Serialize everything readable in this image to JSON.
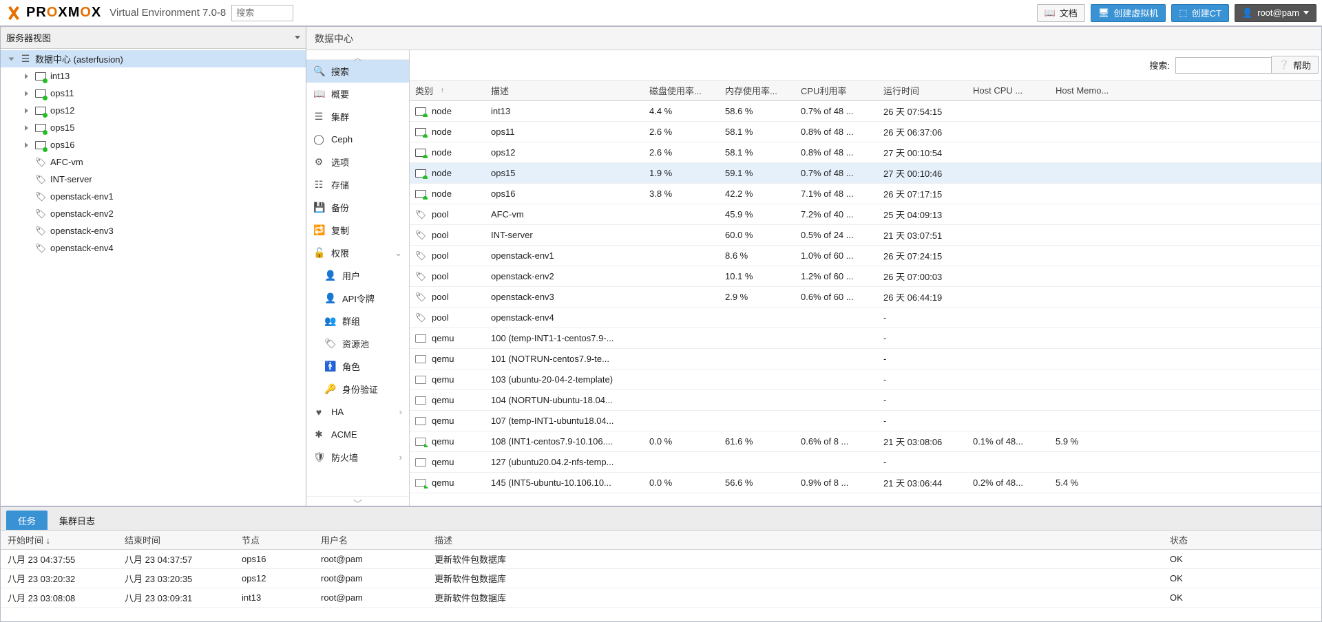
{
  "header": {
    "product": "PROXMOX",
    "suffix": "Virtual Environment 7.0-8",
    "search_placeholder": "搜索",
    "docs": "文档",
    "create_vm": "创建虚拟机",
    "create_ct": "创建CT",
    "user": "root@pam"
  },
  "help_label": "帮助",
  "left": {
    "view": "服务器视图",
    "dc_label": "数据中心 (asterfusion)",
    "nodes": [
      "int13",
      "ops11",
      "ops12",
      "ops15",
      "ops16"
    ],
    "pools": [
      "AFC-vm",
      "INT-server",
      "openstack-env1",
      "openstack-env2",
      "openstack-env3",
      "openstack-env4"
    ]
  },
  "center": {
    "title": "数据中心",
    "search_label": "搜索:",
    "menu": {
      "search": "搜索",
      "summary": "概要",
      "cluster": "集群",
      "ceph": "Ceph",
      "options": "选项",
      "storage": "存储",
      "backup": "备份",
      "replication": "复制",
      "permissions": "权限",
      "users": "用户",
      "api_tokens": "API令牌",
      "groups": "群组",
      "pools": "资源池",
      "roles": "角色",
      "auth": "身份验证",
      "ha": "HA",
      "acme": "ACME",
      "firewall": "防火墙"
    },
    "columns": {
      "type": "类别",
      "desc": "描述",
      "disk": "磁盘使用率...",
      "mem": "内存使用率...",
      "cpu": "CPU利用率",
      "uptime": "运行时间",
      "hostcpu": "Host CPU ...",
      "hostmem": "Host Memo..."
    },
    "rows": [
      {
        "icon": "node",
        "type": "node",
        "desc": "int13",
        "disk": "4.4 %",
        "mem": "58.6 %",
        "cpu": "0.7% of 48 ...",
        "up": "26 天 07:54:15",
        "hcpu": "",
        "hmem": ""
      },
      {
        "icon": "node",
        "type": "node",
        "desc": "ops11",
        "disk": "2.6 %",
        "mem": "58.1 %",
        "cpu": "0.8% of 48 ...",
        "up": "26 天 06:37:06",
        "hcpu": "",
        "hmem": ""
      },
      {
        "icon": "node",
        "type": "node",
        "desc": "ops12",
        "disk": "2.6 %",
        "mem": "58.1 %",
        "cpu": "0.8% of 48 ...",
        "up": "27 天 00:10:54",
        "hcpu": "",
        "hmem": ""
      },
      {
        "icon": "node",
        "type": "node",
        "desc": "ops15",
        "disk": "1.9 %",
        "mem": "59.1 %",
        "cpu": "0.7% of 48 ...",
        "up": "27 天 00:10:46",
        "hcpu": "",
        "hmem": "",
        "hover": true
      },
      {
        "icon": "node",
        "type": "node",
        "desc": "ops16",
        "disk": "3.8 %",
        "mem": "42.2 %",
        "cpu": "7.1% of 48 ...",
        "up": "26 天 07:17:15",
        "hcpu": "",
        "hmem": ""
      },
      {
        "icon": "pool",
        "type": "pool",
        "desc": "AFC-vm",
        "disk": "",
        "mem": "45.9 %",
        "cpu": "7.2% of 40 ...",
        "up": "25 天 04:09:13",
        "hcpu": "",
        "hmem": ""
      },
      {
        "icon": "pool",
        "type": "pool",
        "desc": "INT-server",
        "disk": "",
        "mem": "60.0 %",
        "cpu": "0.5% of 24 ...",
        "up": "21 天 03:07:51",
        "hcpu": "",
        "hmem": ""
      },
      {
        "icon": "pool",
        "type": "pool",
        "desc": "openstack-env1",
        "disk": "",
        "mem": "8.6 %",
        "cpu": "1.0% of 60 ...",
        "up": "26 天 07:24:15",
        "hcpu": "",
        "hmem": ""
      },
      {
        "icon": "pool",
        "type": "pool",
        "desc": "openstack-env2",
        "disk": "",
        "mem": "10.1 %",
        "cpu": "1.2% of 60 ...",
        "up": "26 天 07:00:03",
        "hcpu": "",
        "hmem": ""
      },
      {
        "icon": "pool",
        "type": "pool",
        "desc": "openstack-env3",
        "disk": "",
        "mem": "2.9 %",
        "cpu": "0.6% of 60 ...",
        "up": "26 天 06:44:19",
        "hcpu": "",
        "hmem": ""
      },
      {
        "icon": "pool",
        "type": "pool",
        "desc": "openstack-env4",
        "disk": "",
        "mem": "",
        "cpu": "",
        "up": "-",
        "hcpu": "",
        "hmem": ""
      },
      {
        "icon": "vm-off",
        "type": "qemu",
        "desc": "100 (temp-INT1-1-centos7.9-...",
        "disk": "",
        "mem": "",
        "cpu": "",
        "up": "-",
        "hcpu": "",
        "hmem": ""
      },
      {
        "icon": "vm-off",
        "type": "qemu",
        "desc": "101 (NOTRUN-centos7.9-te...",
        "disk": "",
        "mem": "",
        "cpu": "",
        "up": "-",
        "hcpu": "",
        "hmem": ""
      },
      {
        "icon": "vm-off",
        "type": "qemu",
        "desc": "103 (ubuntu-20-04-2-template)",
        "disk": "",
        "mem": "",
        "cpu": "",
        "up": "-",
        "hcpu": "",
        "hmem": ""
      },
      {
        "icon": "vm-off",
        "type": "qemu",
        "desc": "104 (NORTUN-ubuntu-18.04...",
        "disk": "",
        "mem": "",
        "cpu": "",
        "up": "-",
        "hcpu": "",
        "hmem": ""
      },
      {
        "icon": "vm-off",
        "type": "qemu",
        "desc": "107 (temp-INT1-ubuntu18.04...",
        "disk": "",
        "mem": "",
        "cpu": "",
        "up": "-",
        "hcpu": "",
        "hmem": ""
      },
      {
        "icon": "vm-on",
        "type": "qemu",
        "desc": "108 (INT1-centos7.9-10.106....",
        "disk": "0.0 %",
        "mem": "61.6 %",
        "cpu": "0.6% of 8 ...",
        "up": "21 天 03:08:06",
        "hcpu": "0.1% of 48...",
        "hmem": "5.9 %"
      },
      {
        "icon": "vm-off",
        "type": "qemu",
        "desc": "127 (ubuntu20.04.2-nfs-temp...",
        "disk": "",
        "mem": "",
        "cpu": "",
        "up": "-",
        "hcpu": "",
        "hmem": ""
      },
      {
        "icon": "vm-on",
        "type": "qemu",
        "desc": "145 (INT5-ubuntu-10.106.10...",
        "disk": "0.0 %",
        "mem": "56.6 %",
        "cpu": "0.9% of 8 ...",
        "up": "21 天 03:06:44",
        "hcpu": "0.2% of 48...",
        "hmem": "5.4 %"
      }
    ]
  },
  "tasks": {
    "tab_tasks": "任务",
    "tab_log": "集群日志",
    "columns": {
      "start": "开始时间",
      "end": "结束时间",
      "node": "节点",
      "user": "用户名",
      "desc": "描述",
      "status": "状态"
    },
    "rows": [
      {
        "start": "八月 23 04:37:55",
        "end": "八月 23 04:37:57",
        "node": "ops16",
        "user": "root@pam",
        "desc": "更新软件包数据库",
        "status": "OK"
      },
      {
        "start": "八月 23 03:20:32",
        "end": "八月 23 03:20:35",
        "node": "ops12",
        "user": "root@pam",
        "desc": "更新软件包数据库",
        "status": "OK"
      },
      {
        "start": "八月 23 03:08:08",
        "end": "八月 23 03:09:31",
        "node": "int13",
        "user": "root@pam",
        "desc": "更新软件包数据库",
        "status": "OK"
      }
    ]
  }
}
